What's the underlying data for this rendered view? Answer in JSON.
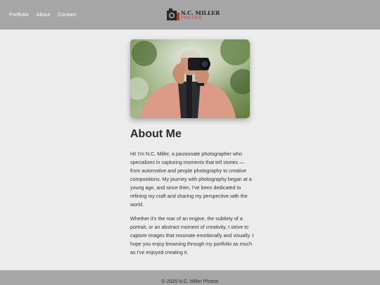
{
  "nav": {
    "links": [
      {
        "label": "Portfolio"
      },
      {
        "label": "About"
      },
      {
        "label": "Contact"
      }
    ]
  },
  "brand": {
    "title": "N.C. MILLER",
    "subtitle": "PHOTOS",
    "accent_color": "#c0392b"
  },
  "about": {
    "heading": "About Me",
    "paragraph1": "Hi! I'm N.C. Miller, a passionate photographer who specializes in capturing moments that tell stories — from automotive and people photography to creative compositions. My journey with photography began at a young age, and since then, I've been dedicated to refining my craft and sharing my perspective with the world.",
    "paragraph2": "Whether it's the roar of an engine, the subtlety of a portrait, or an abstract moment of creativity, I strive to capture images that resonate emotionally and visually. I hope you enjoy browsing through my portfolio as much as I've enjoyed creating it."
  },
  "footer": {
    "copyright": "© 2025 N.C. Miller Photos"
  },
  "colors": {
    "navbar_bg": "#a6a6a6",
    "page_bg": "#ececec",
    "text": "#2b2b2b"
  }
}
